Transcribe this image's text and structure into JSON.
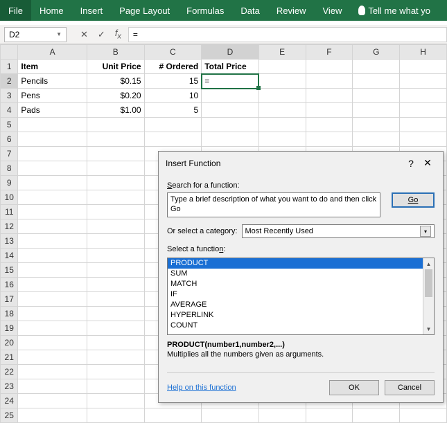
{
  "ribbon": {
    "tabs": [
      "File",
      "Home",
      "Insert",
      "Page Layout",
      "Formulas",
      "Data",
      "Review",
      "View"
    ],
    "tell_me": "Tell me what yo"
  },
  "namebox": {
    "value": "D2"
  },
  "formula_bar": {
    "value": "="
  },
  "columns": [
    "A",
    "B",
    "C",
    "D",
    "E",
    "F",
    "G",
    "H"
  ],
  "rows": {
    "count": 25,
    "headers": {
      "A": "Item",
      "B": "Unit Price",
      "C": "# Ordered",
      "D": "Total Price"
    },
    "data": [
      {
        "item": "Pencils",
        "price": "$0.15",
        "ordered": "15",
        "total": "="
      },
      {
        "item": "Pens",
        "price": "$0.20",
        "ordered": "10",
        "total": ""
      },
      {
        "item": "Pads",
        "price": "$1.00",
        "ordered": "5",
        "total": ""
      }
    ]
  },
  "dialog": {
    "title": "Insert Function",
    "search_label": "Search for a function:",
    "search_text": "Type a brief description of what you want to do and then click Go",
    "go": "Go",
    "cat_label": "Or select a category:",
    "cat_value": "Most Recently Used",
    "list_label": "Select a function:",
    "functions": [
      "PRODUCT",
      "SUM",
      "MATCH",
      "IF",
      "AVERAGE",
      "HYPERLINK",
      "COUNT"
    ],
    "signature": "PRODUCT(number1,number2,...)",
    "description": "Multiplies all the numbers given as arguments.",
    "help_link": "Help on this function",
    "ok": "OK",
    "cancel": "Cancel"
  }
}
